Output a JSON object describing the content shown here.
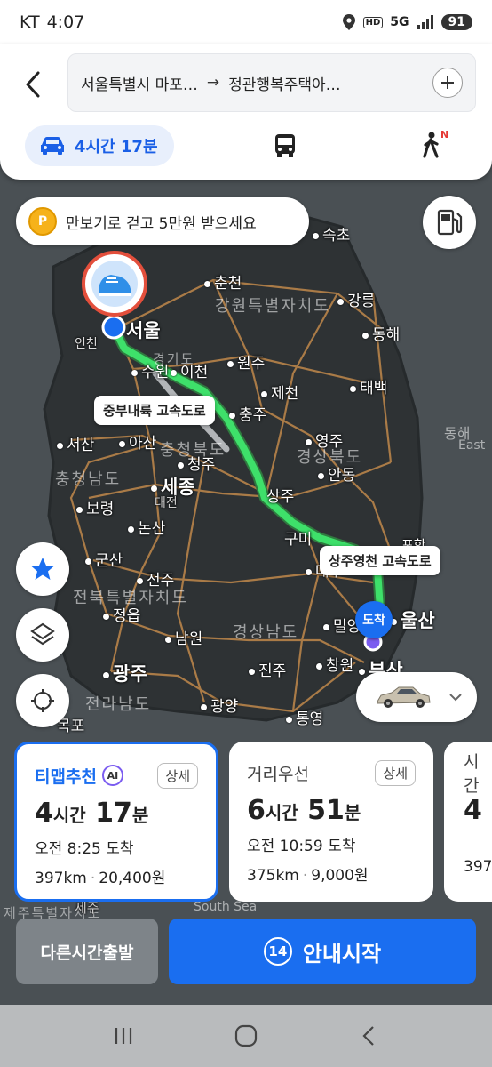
{
  "status_bar": {
    "carrier": "KT",
    "time": "4:07",
    "network_hd": "HD",
    "network_5g": "5G",
    "battery": "91"
  },
  "search": {
    "from": "서울특별시 마포…",
    "arrow": "→",
    "to": "정관행복주택아…"
  },
  "mode_tabs": {
    "car_label": "4시간 17분",
    "walk_badge": "N"
  },
  "promo": {
    "coin_symbol": "P",
    "text": "만보기로 걷고 5만원 받으세요"
  },
  "map": {
    "cities": [
      {
        "name": "서울",
        "big": true
      },
      {
        "name": "인천"
      },
      {
        "name": "수원"
      },
      {
        "name": "이천"
      },
      {
        "name": "춘천"
      },
      {
        "name": "원주"
      },
      {
        "name": "강릉"
      },
      {
        "name": "동해"
      },
      {
        "name": "속초"
      },
      {
        "name": "제천"
      },
      {
        "name": "충주"
      },
      {
        "name": "태백"
      },
      {
        "name": "영주"
      },
      {
        "name": "안동"
      },
      {
        "name": "서산"
      },
      {
        "name": "아산"
      },
      {
        "name": "청주"
      },
      {
        "name": "세종",
        "big": true
      },
      {
        "name": "대전"
      },
      {
        "name": "상주"
      },
      {
        "name": "보령"
      },
      {
        "name": "논산"
      },
      {
        "name": "구미"
      },
      {
        "name": "포항"
      },
      {
        "name": "대구"
      },
      {
        "name": "군산"
      },
      {
        "name": "전주"
      },
      {
        "name": "정읍"
      },
      {
        "name": "남원"
      },
      {
        "name": "밀양"
      },
      {
        "name": "울산",
        "big": true
      },
      {
        "name": "광주",
        "big": true
      },
      {
        "name": "진주"
      },
      {
        "name": "창원"
      },
      {
        "name": "부산",
        "big": true
      },
      {
        "name": "광양"
      },
      {
        "name": "통영"
      },
      {
        "name": "목포"
      },
      {
        "name": "세주"
      }
    ],
    "regions": [
      "강원특별자치도",
      "경기도",
      "충청북도",
      "경상북도",
      "충청남도",
      "전북특별자치도",
      "경상남도",
      "전라남도",
      "제주특별자치도"
    ],
    "sea_labels": [
      "동해",
      "East",
      "South Sea"
    ],
    "road_labels": [
      "중부내륙 고속도로",
      "상주영천 고속도로"
    ],
    "arrive_label": "도착"
  },
  "route_cards": [
    {
      "name": "티맵추천",
      "ai": "AI",
      "detail": "상세",
      "hours": "4",
      "hours_unit": "시간",
      "mins": "17",
      "mins_unit": "분",
      "arrival": "오전 8:25 도착",
      "distance": "397km",
      "fare": "20,400원",
      "active": true
    },
    {
      "name": "거리우선",
      "detail": "상세",
      "hours": "6",
      "hours_unit": "시간",
      "mins": "51",
      "mins_unit": "분",
      "arrival": "오전 10:59 도착",
      "distance": "375km",
      "fare": "9,000원",
      "active": false
    },
    {
      "name": "시간",
      "hours": "4",
      "distance": "397"
    }
  ],
  "buttons": {
    "other_time": "다른시간출발",
    "start_nav": "안내시작",
    "start_count": "14"
  },
  "colors": {
    "accent": "#1a6ef0",
    "route": "#3ee06a",
    "start_marker": "#e34f3c"
  }
}
